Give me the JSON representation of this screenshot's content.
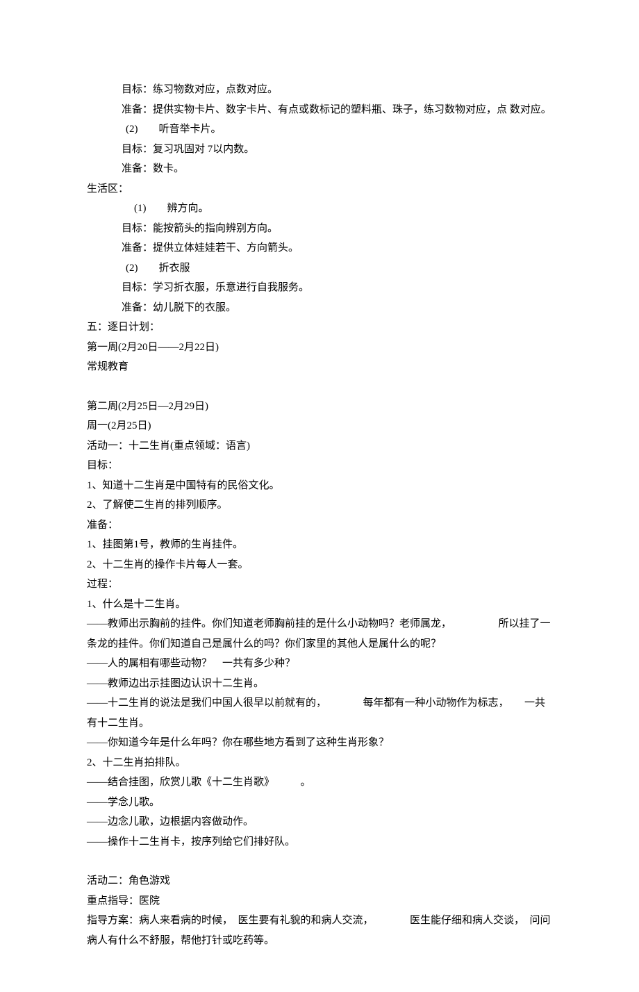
{
  "lines": [
    {
      "class": "line indent1",
      "text": "目标：练习物数对应，点数对应。"
    },
    {
      "class": "line indent1",
      "text": "准备：提供实物卡片、数字卡片、有点或数标记的塑料瓶、珠子，练习数物对应，点 数对应。"
    },
    {
      "class": "line num-indent",
      "text": "(2)　　听音举卡片。"
    },
    {
      "class": "line indent1",
      "text": "目标：复习巩固对 7以内数。"
    },
    {
      "class": "line indent1",
      "text": "准备：数卡。"
    },
    {
      "class": "line",
      "text": "生活区："
    },
    {
      "class": "line indent2",
      "text": "(1)　　辨方向。"
    },
    {
      "class": "line indent1",
      "text": "目标：能按箭头的指向辨别方向。"
    },
    {
      "class": "line indent1",
      "text": "准备：提供立体娃娃若干、方向箭头。"
    },
    {
      "class": "line num-indent",
      "text": "(2)　　折衣服"
    },
    {
      "class": "line indent1",
      "text": "目标：学习折衣服，乐意进行自我服务。"
    },
    {
      "class": "line indent1",
      "text": "准备：幼儿脱下的衣服。"
    },
    {
      "class": "line",
      "text": "五：逐日计划："
    },
    {
      "class": "line",
      "text": "第一周(2月20日――2月22日)"
    },
    {
      "class": "line",
      "text": "常规教育"
    },
    {
      "class": "blank",
      "text": ""
    },
    {
      "class": "line",
      "text": "第二周(2月25日—2月29日)"
    },
    {
      "class": "line",
      "text": "周一(2月25日)"
    },
    {
      "class": "line",
      "text": "活动一：十二生肖(重点领域：语言)"
    },
    {
      "class": "line",
      "text": "目标："
    },
    {
      "class": "line",
      "text": "1、知道十二生肖是中国特有的民俗文化。"
    },
    {
      "class": "line",
      "text": "2、了解使二生肖的排列顺序。"
    },
    {
      "class": "line",
      "text": "准备："
    },
    {
      "class": "line",
      "text": "1、挂图第1号，教师的生肖挂件。"
    },
    {
      "class": "line",
      "text": "2、十二生肖的操作卡片每人一套。"
    },
    {
      "class": "line",
      "text": "过程："
    },
    {
      "class": "line",
      "text": "1、什么是十二生肖。"
    },
    {
      "class": "line",
      "text": "——教师出示胸前的挂件。你们知道老师胸前挂的是什么小动物吗？老师属龙，　　　　　所以挂了一条龙的挂件。你们知道自己是属什么的吗？你们家里的其他人是属什么的呢？"
    },
    {
      "class": "line",
      "text": "——人的属相有哪些动物？　一共有多少种？"
    },
    {
      "class": "line",
      "text": "——教师边出示挂图边认识十二生肖。"
    },
    {
      "class": "line",
      "text": "——十二生肖的说法是我们中国人很早以前就有的，　　　　每年都有一种小动物作为标志，　　一共有十二生肖。"
    },
    {
      "class": "line",
      "text": "——你知道今年是什么年吗？你在哪些地方看到了这种生肖形象？"
    },
    {
      "class": "line",
      "text": "2、十二生肖拍排队。"
    },
    {
      "class": "line",
      "text": "——结合挂图，欣赏儿歌《十二生肖歌》　　　。"
    },
    {
      "class": "line",
      "text": "——学念儿歌。"
    },
    {
      "class": "line",
      "text": "——边念儿歌，边根据内容做动作。"
    },
    {
      "class": "line",
      "text": "——操作十二生肖卡，按序列给它们排好队。"
    },
    {
      "class": "blank",
      "text": ""
    },
    {
      "class": "line",
      "text": "活动二：角色游戏"
    },
    {
      "class": "line",
      "text": "重点指导：医院"
    },
    {
      "class": "line",
      "text": "指导方案：病人来看病的时候，　医生要有礼貌的和病人交流，　　　　医生能仔细和病人交谈，　问问病人有什么不舒服，帮他打针或吃药等。"
    }
  ]
}
